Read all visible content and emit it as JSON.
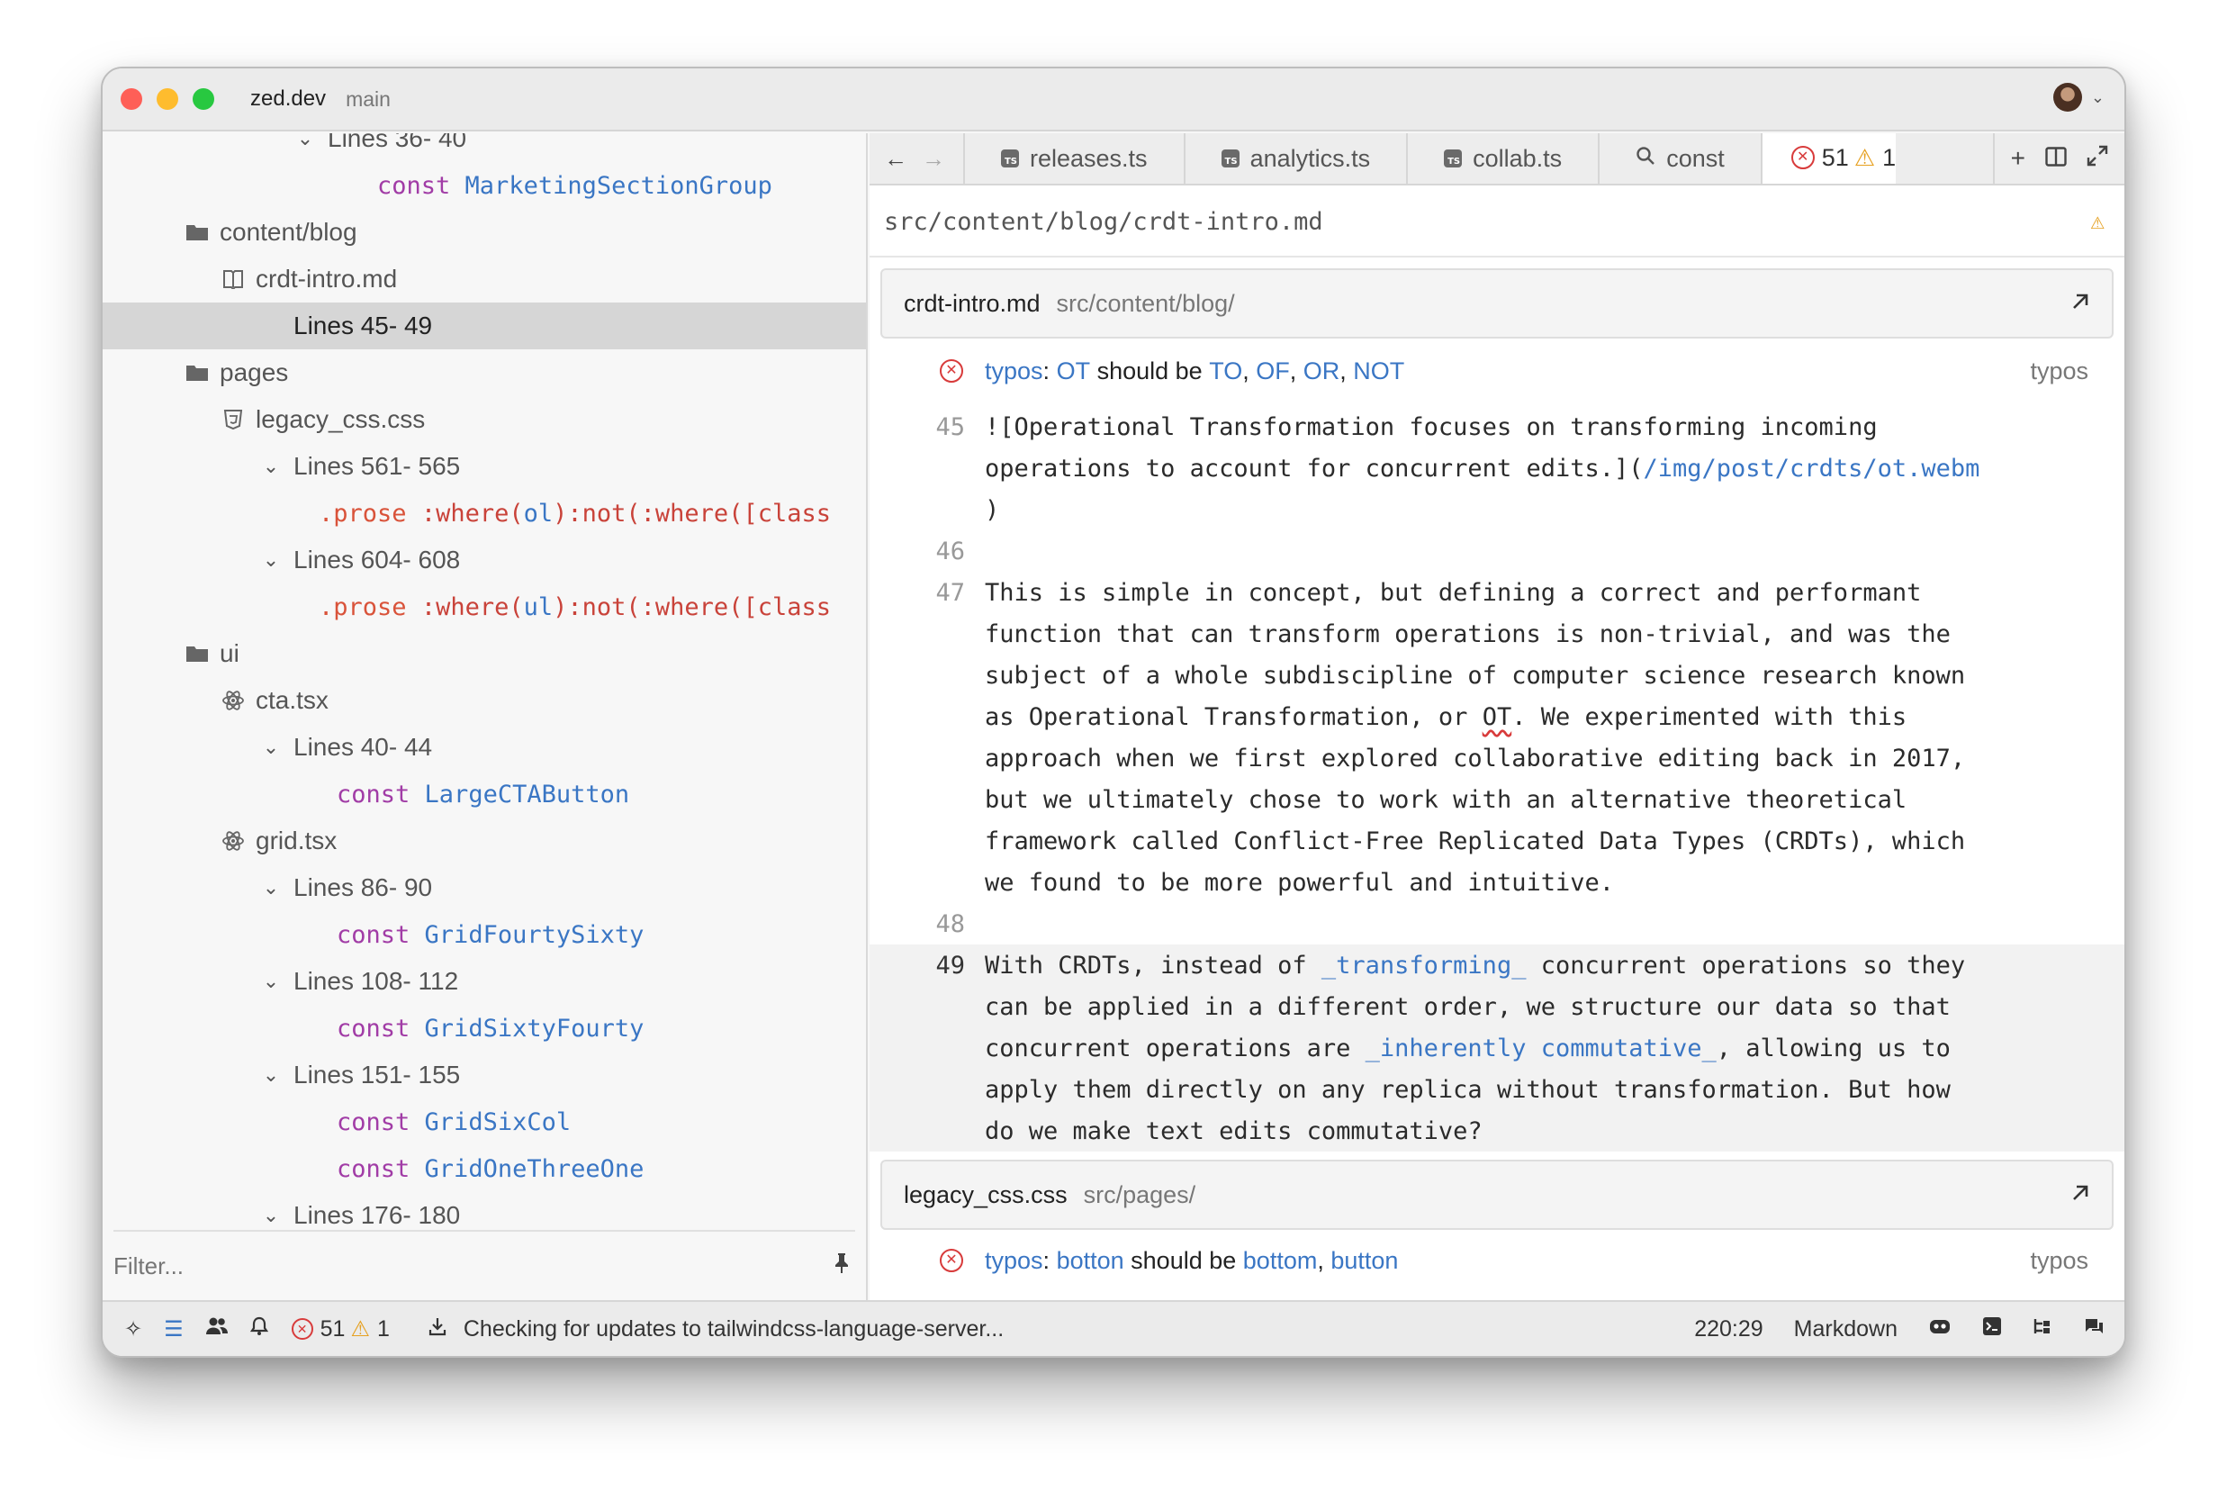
{
  "window": {
    "app_name": "zed.dev",
    "branch": "main"
  },
  "outline": {
    "rows": [
      {
        "kind": "range",
        "label": "Lines 36- 40"
      },
      {
        "kind": "symbol",
        "keyword": "const",
        "name": "MarketingSectionGroup"
      },
      {
        "kind": "folder",
        "label": "content/blog"
      },
      {
        "kind": "file",
        "label": "crdt-intro.md"
      },
      {
        "kind": "range",
        "label": "Lines 45- 49"
      },
      {
        "kind": "folder",
        "label": "pages"
      },
      {
        "kind": "file",
        "label": "legacy_css.css"
      },
      {
        "kind": "range",
        "label": "Lines 561- 565"
      },
      {
        "kind": "css",
        "selector": ".prose",
        "rest_pre": ":where(",
        "arg": "ol",
        "rest_mid": "):not(:where([class"
      },
      {
        "kind": "range",
        "label": "Lines 604- 608"
      },
      {
        "kind": "css",
        "selector": ".prose",
        "rest_pre": ":where(",
        "arg": "ul",
        "rest_mid": "):not(:where([class"
      },
      {
        "kind": "folder",
        "label": "ui"
      },
      {
        "kind": "file",
        "label": "cta.tsx"
      },
      {
        "kind": "range",
        "label": "Lines 40- 44"
      },
      {
        "kind": "symbol",
        "keyword": "const",
        "name": "LargeCTAButton"
      },
      {
        "kind": "file",
        "label": "grid.tsx"
      },
      {
        "kind": "range",
        "label": "Lines 86- 90"
      },
      {
        "kind": "symbol",
        "keyword": "const",
        "name": "GridFourtySixty"
      },
      {
        "kind": "range",
        "label": "Lines 108- 112"
      },
      {
        "kind": "symbol",
        "keyword": "const",
        "name": "GridSixtyFourty"
      },
      {
        "kind": "range",
        "label": "Lines 151- 155"
      },
      {
        "kind": "symbol",
        "keyword": "const",
        "name": "GridSixCol"
      },
      {
        "kind": "symbol",
        "keyword": "const",
        "name": "GridOneThreeOne"
      },
      {
        "kind": "range",
        "label": "Lines 176- 180"
      }
    ],
    "filter_placeholder": "Filter..."
  },
  "tabs": [
    {
      "label": "releases.ts",
      "icon": "typescript-file-icon"
    },
    {
      "label": "analytics.ts",
      "icon": "typescript-file-icon"
    },
    {
      "label": "collab.ts",
      "icon": "typescript-file-icon"
    },
    {
      "label": "const",
      "icon": "search-icon"
    }
  ],
  "active_tab": {
    "errors": "51",
    "warnings": "1"
  },
  "breadcrumb": "src/content/blog/crdt-intro.md",
  "excerpts": [
    {
      "file": "crdt-intro.md",
      "path": "src/content/blog/",
      "diagnostic": {
        "source": "typos",
        "word": "OT",
        "middle": "should be",
        "suggestions": [
          "TO",
          "OF",
          "OR",
          "NOT"
        ],
        "tag": "typos"
      }
    },
    {
      "file": "legacy_css.css",
      "path": "src/pages/",
      "diagnostic": {
        "source": "typos",
        "word": "botton",
        "middle": "should be",
        "suggestions": [
          "bottom",
          "button"
        ],
        "tag": "typos"
      }
    }
  ],
  "code": {
    "l45_num": "45",
    "l45_a": "![Operational Transformation focuses on transforming incoming",
    "l45_b": "operations to account for concurrent edits.](",
    "l45_link": "/img/post/crdts/ot.webm",
    "l45_c": ")",
    "l46_num": "46",
    "l47_num": "47",
    "l47_lines": [
      "This is simple in concept, but defining a correct and performant",
      "function that can transform operations is non-trivial, and was the",
      "subject of a whole subdiscipline of computer science research known"
    ],
    "l47_d_pre": "as Operational Transformation, or ",
    "l47_d_ot": "OT",
    "l47_d_post": ". We experimented with this",
    "l47_rest": [
      "approach when we first explored collaborative editing back in 2017,",
      "but we ultimately chose to work with an alternative theoretical",
      "framework called Conflict-Free Replicated Data Types (CRDTs), which",
      "we found to be more powerful and intuitive."
    ],
    "l48_num": "48",
    "l49_num": "49",
    "l49_a_pre": "With CRDTs, instead of ",
    "l49_a_em": "_transforming_",
    "l49_a_post": " concurrent operations so they",
    "l49_b": "can be applied in a different order, we structure our data so that",
    "l49_c_pre": "concurrent operations are ",
    "l49_c_em": "_inherently commutative_",
    "l49_c_post": ", allowing us to",
    "l49_d": "apply them directly on any replica without transformation. But how",
    "l49_e": "do we make text edits commutative?"
  },
  "status": {
    "errors": "51",
    "warnings": "1",
    "message": "Checking for updates to tailwindcss-language-server...",
    "cursor": "220:29",
    "language": "Markdown"
  }
}
